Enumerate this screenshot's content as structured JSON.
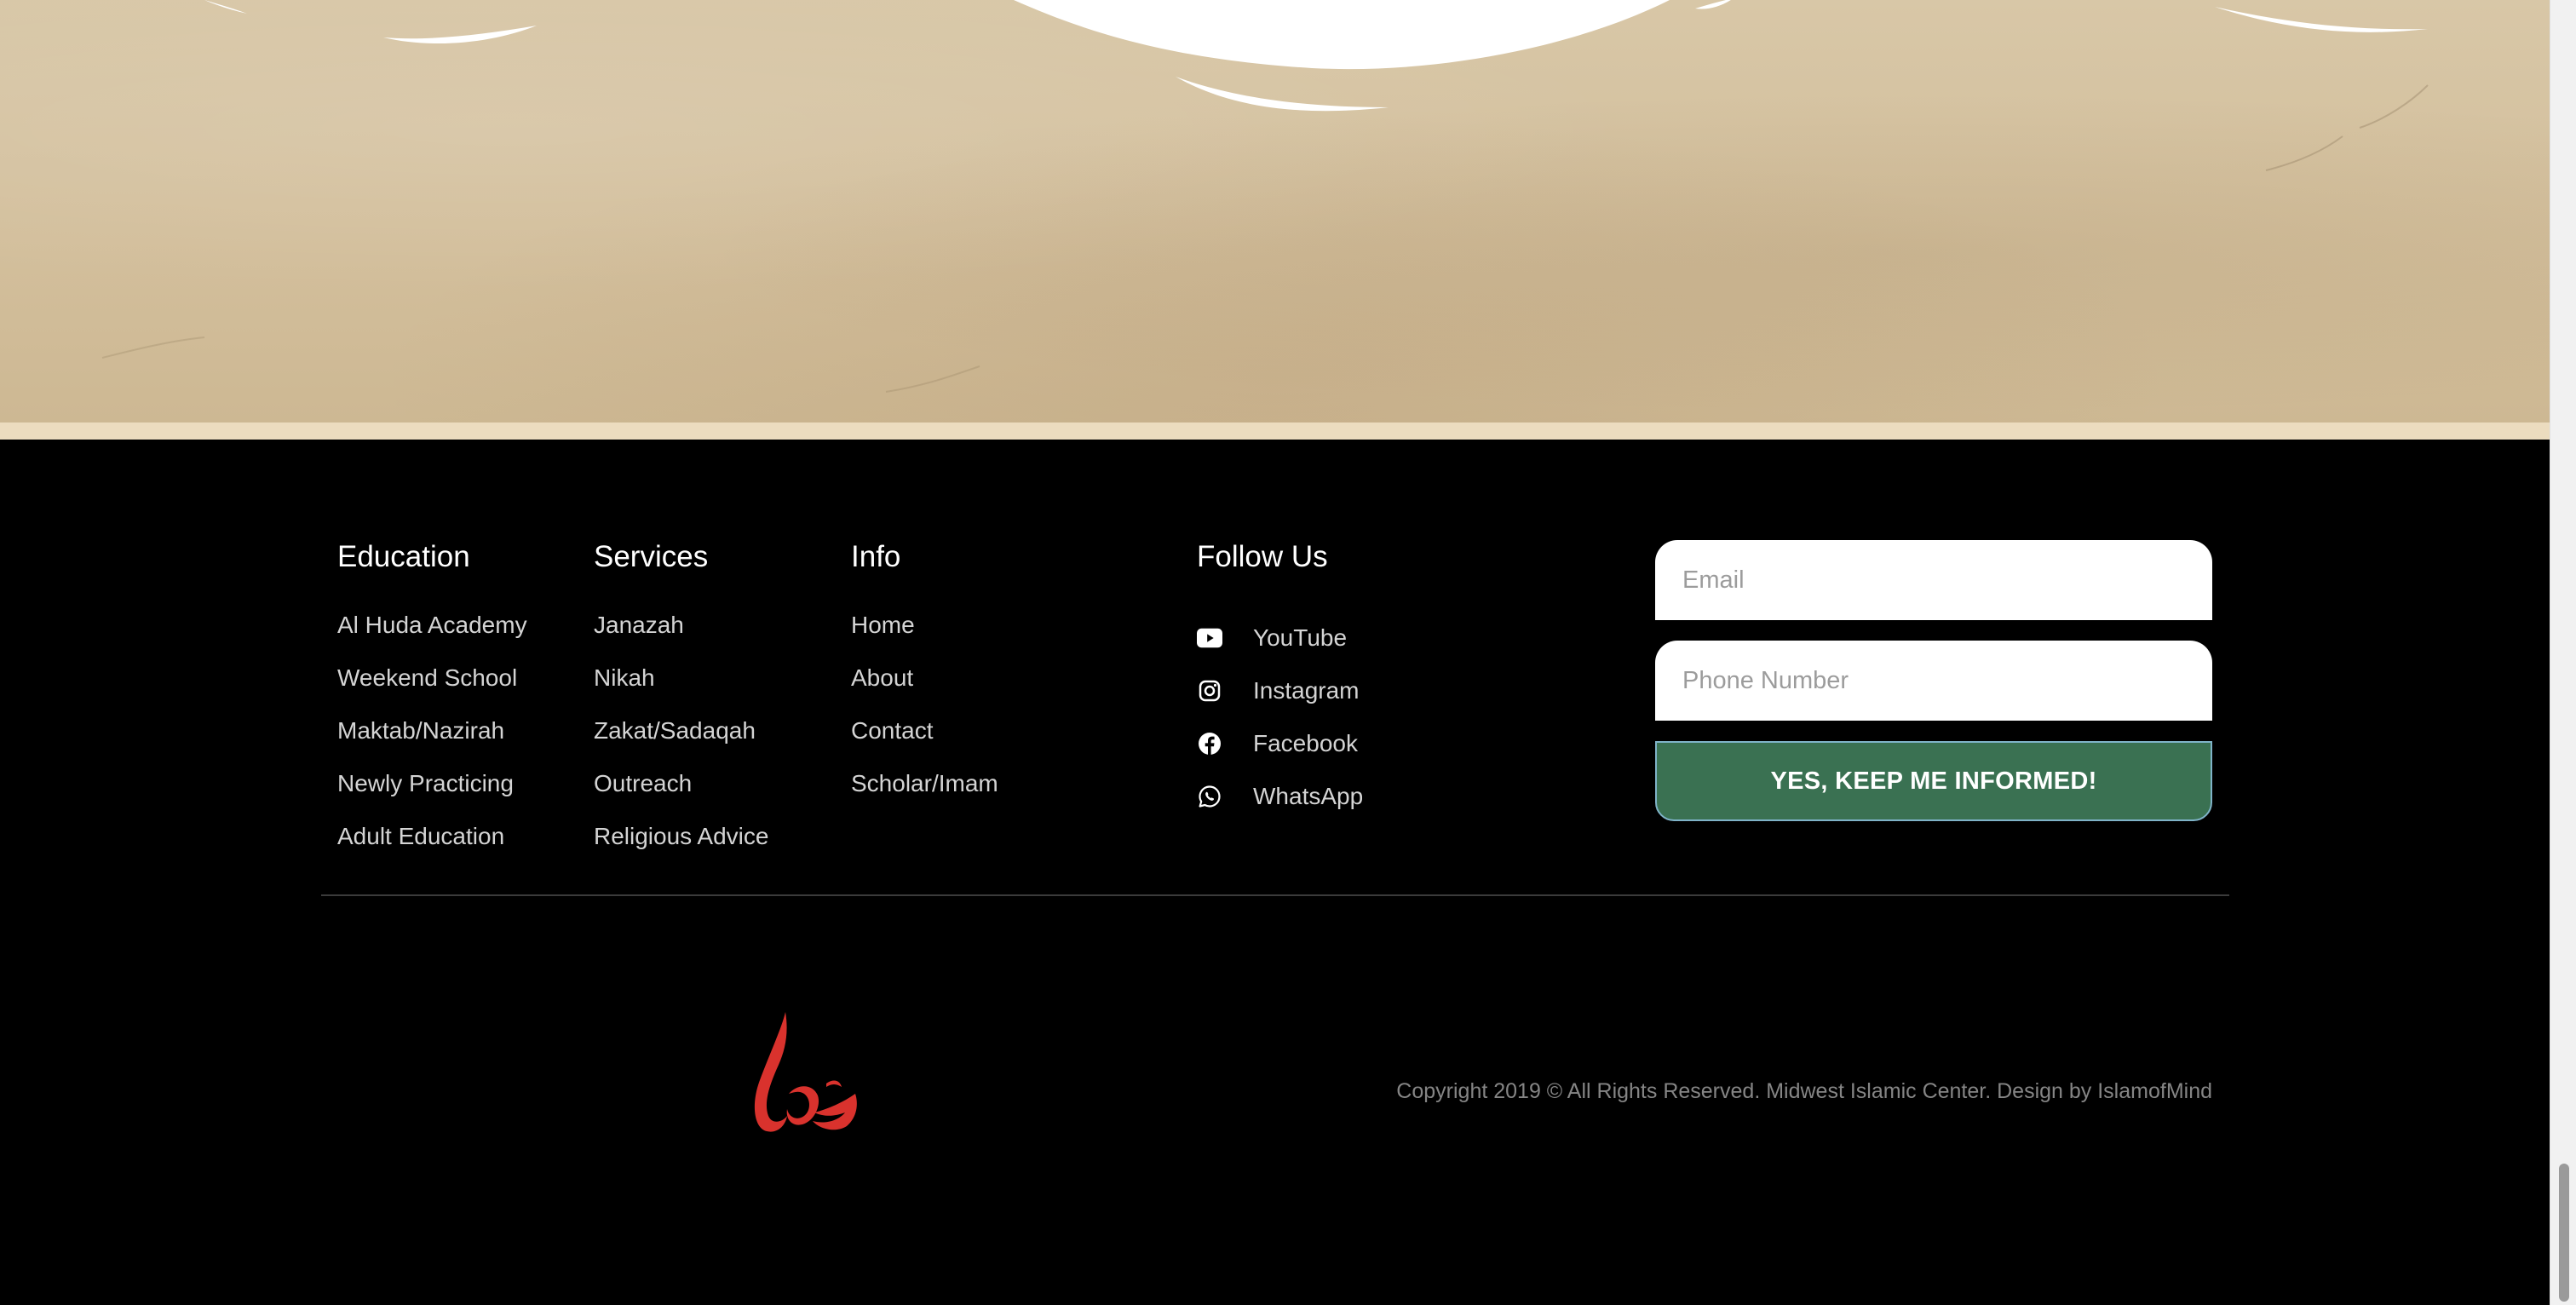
{
  "footer": {
    "columns": {
      "education": {
        "title": "Education",
        "items": [
          "Al Huda Academy",
          "Weekend School",
          "Maktab/Nazirah",
          "Newly Practicing",
          "Adult Education"
        ]
      },
      "services": {
        "title": "Services",
        "items": [
          "Janazah",
          "Nikah",
          "Zakat/Sadaqah",
          "Outreach",
          "Religious Advice"
        ]
      },
      "info": {
        "title": "Info",
        "items": [
          "Home",
          "About",
          "Contact",
          "Scholar/Imam"
        ]
      },
      "follow": {
        "title": "Follow Us",
        "items": [
          {
            "label": "YouTube",
            "icon": "youtube-icon"
          },
          {
            "label": "Instagram",
            "icon": "instagram-icon"
          },
          {
            "label": "Facebook",
            "icon": "facebook-icon"
          },
          {
            "label": "WhatsApp",
            "icon": "whatsapp-icon"
          }
        ]
      }
    },
    "form": {
      "email_placeholder": "Email",
      "email_value": "",
      "phone_placeholder": "Phone Number",
      "phone_value": "",
      "submit_label": "YES, KEEP ME INFORMED!"
    },
    "logo": {
      "text": "هدى",
      "color": "#d9322d"
    },
    "copyright": "Copyright 2019 © All Rights Reserved. Midwest Islamic Center. Design by IslamofMind"
  },
  "colors": {
    "parchment": "#d6c4a3",
    "band": "#ecdcbf",
    "footer_bg": "#000000",
    "button_bg": "#3a7152",
    "button_border": "#7fb3c8",
    "logo_red": "#d9322d"
  }
}
